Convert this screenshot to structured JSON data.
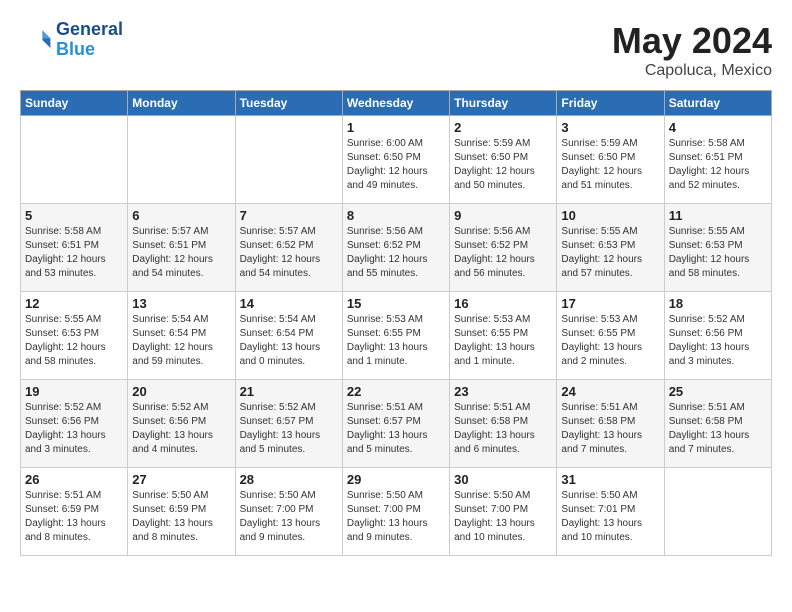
{
  "header": {
    "logo_text_general": "General",
    "logo_text_blue": "Blue",
    "month": "May 2024",
    "location": "Capoluca, Mexico"
  },
  "weekdays": [
    "Sunday",
    "Monday",
    "Tuesday",
    "Wednesday",
    "Thursday",
    "Friday",
    "Saturday"
  ],
  "weeks": [
    [
      {
        "day": "",
        "info": ""
      },
      {
        "day": "",
        "info": ""
      },
      {
        "day": "",
        "info": ""
      },
      {
        "day": "1",
        "info": "Sunrise: 6:00 AM\nSunset: 6:50 PM\nDaylight: 12 hours\nand 49 minutes."
      },
      {
        "day": "2",
        "info": "Sunrise: 5:59 AM\nSunset: 6:50 PM\nDaylight: 12 hours\nand 50 minutes."
      },
      {
        "day": "3",
        "info": "Sunrise: 5:59 AM\nSunset: 6:50 PM\nDaylight: 12 hours\nand 51 minutes."
      },
      {
        "day": "4",
        "info": "Sunrise: 5:58 AM\nSunset: 6:51 PM\nDaylight: 12 hours\nand 52 minutes."
      }
    ],
    [
      {
        "day": "5",
        "info": "Sunrise: 5:58 AM\nSunset: 6:51 PM\nDaylight: 12 hours\nand 53 minutes."
      },
      {
        "day": "6",
        "info": "Sunrise: 5:57 AM\nSunset: 6:51 PM\nDaylight: 12 hours\nand 54 minutes."
      },
      {
        "day": "7",
        "info": "Sunrise: 5:57 AM\nSunset: 6:52 PM\nDaylight: 12 hours\nand 54 minutes."
      },
      {
        "day": "8",
        "info": "Sunrise: 5:56 AM\nSunset: 6:52 PM\nDaylight: 12 hours\nand 55 minutes."
      },
      {
        "day": "9",
        "info": "Sunrise: 5:56 AM\nSunset: 6:52 PM\nDaylight: 12 hours\nand 56 minutes."
      },
      {
        "day": "10",
        "info": "Sunrise: 5:55 AM\nSunset: 6:53 PM\nDaylight: 12 hours\nand 57 minutes."
      },
      {
        "day": "11",
        "info": "Sunrise: 5:55 AM\nSunset: 6:53 PM\nDaylight: 12 hours\nand 58 minutes."
      }
    ],
    [
      {
        "day": "12",
        "info": "Sunrise: 5:55 AM\nSunset: 6:53 PM\nDaylight: 12 hours\nand 58 minutes."
      },
      {
        "day": "13",
        "info": "Sunrise: 5:54 AM\nSunset: 6:54 PM\nDaylight: 12 hours\nand 59 minutes."
      },
      {
        "day": "14",
        "info": "Sunrise: 5:54 AM\nSunset: 6:54 PM\nDaylight: 13 hours\nand 0 minutes."
      },
      {
        "day": "15",
        "info": "Sunrise: 5:53 AM\nSunset: 6:55 PM\nDaylight: 13 hours\nand 1 minute."
      },
      {
        "day": "16",
        "info": "Sunrise: 5:53 AM\nSunset: 6:55 PM\nDaylight: 13 hours\nand 1 minute."
      },
      {
        "day": "17",
        "info": "Sunrise: 5:53 AM\nSunset: 6:55 PM\nDaylight: 13 hours\nand 2 minutes."
      },
      {
        "day": "18",
        "info": "Sunrise: 5:52 AM\nSunset: 6:56 PM\nDaylight: 13 hours\nand 3 minutes."
      }
    ],
    [
      {
        "day": "19",
        "info": "Sunrise: 5:52 AM\nSunset: 6:56 PM\nDaylight: 13 hours\nand 3 minutes."
      },
      {
        "day": "20",
        "info": "Sunrise: 5:52 AM\nSunset: 6:56 PM\nDaylight: 13 hours\nand 4 minutes."
      },
      {
        "day": "21",
        "info": "Sunrise: 5:52 AM\nSunset: 6:57 PM\nDaylight: 13 hours\nand 5 minutes."
      },
      {
        "day": "22",
        "info": "Sunrise: 5:51 AM\nSunset: 6:57 PM\nDaylight: 13 hours\nand 5 minutes."
      },
      {
        "day": "23",
        "info": "Sunrise: 5:51 AM\nSunset: 6:58 PM\nDaylight: 13 hours\nand 6 minutes."
      },
      {
        "day": "24",
        "info": "Sunrise: 5:51 AM\nSunset: 6:58 PM\nDaylight: 13 hours\nand 7 minutes."
      },
      {
        "day": "25",
        "info": "Sunrise: 5:51 AM\nSunset: 6:58 PM\nDaylight: 13 hours\nand 7 minutes."
      }
    ],
    [
      {
        "day": "26",
        "info": "Sunrise: 5:51 AM\nSunset: 6:59 PM\nDaylight: 13 hours\nand 8 minutes."
      },
      {
        "day": "27",
        "info": "Sunrise: 5:50 AM\nSunset: 6:59 PM\nDaylight: 13 hours\nand 8 minutes."
      },
      {
        "day": "28",
        "info": "Sunrise: 5:50 AM\nSunset: 7:00 PM\nDaylight: 13 hours\nand 9 minutes."
      },
      {
        "day": "29",
        "info": "Sunrise: 5:50 AM\nSunset: 7:00 PM\nDaylight: 13 hours\nand 9 minutes."
      },
      {
        "day": "30",
        "info": "Sunrise: 5:50 AM\nSunset: 7:00 PM\nDaylight: 13 hours\nand 10 minutes."
      },
      {
        "day": "31",
        "info": "Sunrise: 5:50 AM\nSunset: 7:01 PM\nDaylight: 13 hours\nand 10 minutes."
      },
      {
        "day": "",
        "info": ""
      }
    ]
  ]
}
